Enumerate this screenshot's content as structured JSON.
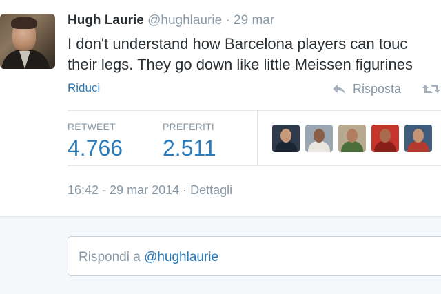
{
  "tweet": {
    "author": {
      "fullname": "Hugh Laurie",
      "username": "@hughlaurie"
    },
    "separator": "·",
    "date": "29 mar",
    "text_line1": "I don't understand how Barcelona players can touc",
    "text_line2": "their legs. They go down like little Meissen figurines",
    "collapse_label": "Riduci",
    "actions": {
      "reply_label": "Risposta"
    },
    "stats": {
      "retweets_label": "RETWEET",
      "retweets_value": "4.766",
      "favorites_label": "PREFERITI",
      "favorites_value": "2.511"
    },
    "favoriters": [
      {
        "name": "favoriter-1",
        "bg": "#2e3a4a",
        "skin": "#c89a7a",
        "cloth": "#1b2533"
      },
      {
        "name": "favoriter-2",
        "bg": "#9aa6b2",
        "skin": "#8a5e44",
        "cloth": "#e9e6e0"
      },
      {
        "name": "favoriter-3",
        "bg": "#b7a98f",
        "skin": "#b07d5e",
        "cloth": "#4a6f3a"
      },
      {
        "name": "favoriter-4",
        "bg": "#c4352d",
        "skin": "#a86b4d",
        "cloth": "#8c1e1a"
      },
      {
        "name": "favoriter-5",
        "bg": "#3f5c7c",
        "skin": "#c49575",
        "cloth": "#b43a2f"
      }
    ],
    "timestamp": {
      "time": "16:42 - 29 mar 2014",
      "separator": "·",
      "details_label": "Dettagli"
    }
  },
  "reply": {
    "placeholder_prefix": "Rispondi a ",
    "placeholder_mention": "@hughlaurie"
  },
  "colors": {
    "link": "#2b7bb9",
    "muted": "#8899a6",
    "text": "#292f33",
    "divider": "#e1e8ed",
    "reply_bg": "#f5f8fa"
  }
}
